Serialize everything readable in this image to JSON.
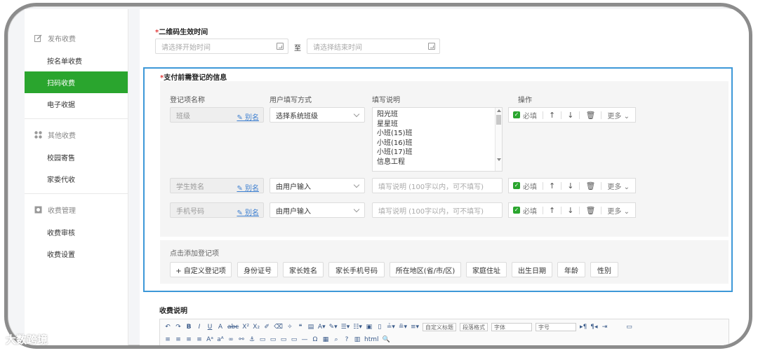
{
  "sidebar": {
    "groups": [
      {
        "title": "发布收费",
        "icon": "edit-icon",
        "items": [
          "按名单收费",
          "扫码收费",
          "电子收据"
        ]
      },
      {
        "title": "其他收费",
        "icon": "apps-icon",
        "items": [
          "校园寄售",
          "家委代收"
        ]
      },
      {
        "title": "收费管理",
        "icon": "settings-icon",
        "items": [
          "收费审核",
          "收费设置"
        ]
      }
    ],
    "active": "扫码收费"
  },
  "qr_time": {
    "label": "二维码生效时间",
    "start_placeholder": "请选择开始时间",
    "sep": "至",
    "end_placeholder": "请选择结束时间"
  },
  "registration": {
    "label": "支付前需登记的信息",
    "columns": [
      "登记项名称",
      "用户填写方式",
      "填写说明",
      "操作"
    ],
    "alias_label": "别名",
    "required_label": "必填",
    "more_label": "更多",
    "rows": [
      {
        "name": "班级",
        "mode": "选择系统班级",
        "options": [
          "阳光班",
          "星星班",
          "小班(15)班",
          "小班(16)班",
          "小班(17)班",
          "信息工程"
        ]
      },
      {
        "name": "学生姓名",
        "mode": "由用户输入",
        "desc_placeholder": "填写说明 (100字以内，可不填写)"
      },
      {
        "name": "手机号码",
        "mode": "由用户输入",
        "desc_placeholder": "填写说明 (100字以内，可不填写)"
      }
    ],
    "add_title": "点击添加登记项",
    "add_items": [
      "+ 自定义登记项",
      "身份证号",
      "家长姓名",
      "家长手机号码",
      "所在地区(省/市/区)",
      "家庭住址",
      "出生日期",
      "年龄",
      "性别"
    ]
  },
  "fee_desc": {
    "label": "收费说明",
    "toolbar": {
      "custom_title": "自定义标题",
      "para_format": "段落格式",
      "font_family": "字体",
      "font_size": "字号"
    }
  },
  "watermark": "大数跨境"
}
